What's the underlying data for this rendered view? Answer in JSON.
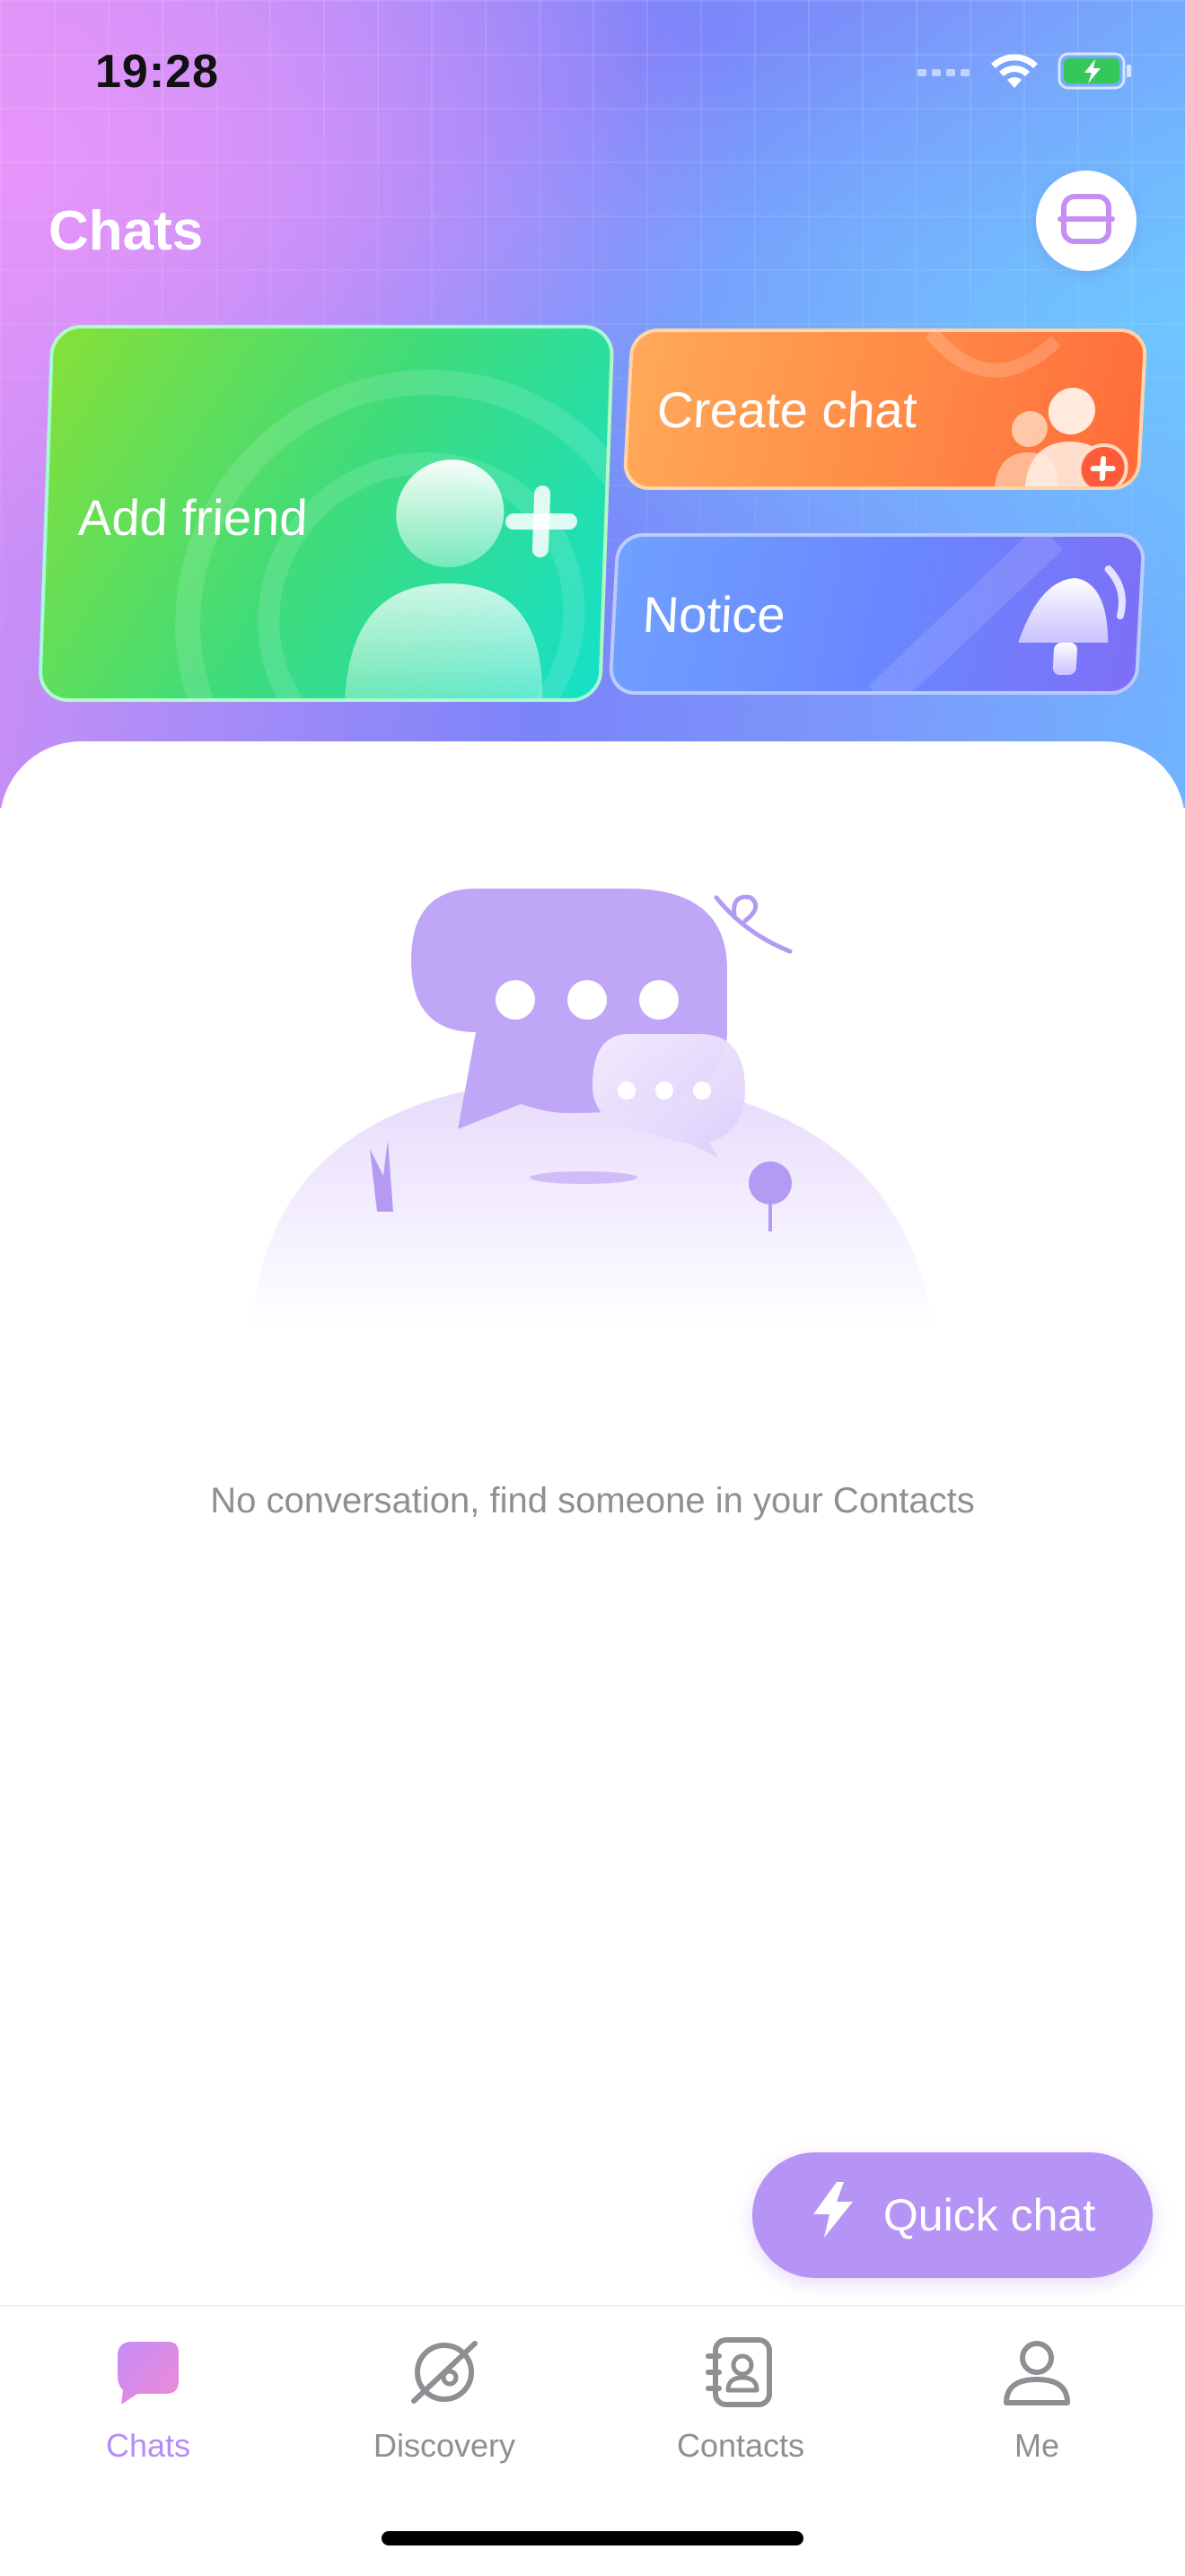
{
  "status_bar": {
    "time": "19:28",
    "icons": [
      "signal-icon",
      "wifi-icon",
      "battery-charging-icon"
    ]
  },
  "header": {
    "title": "Chats",
    "scan_icon": "scan-icon"
  },
  "action_cards": {
    "add_friend": "Add friend",
    "create_chat": "Create chat",
    "notice": "Notice"
  },
  "empty_state": {
    "message": "No conversation, find someone in your Contacts",
    "illustration": "chat-bubbles-illustration"
  },
  "quick_chat": {
    "label": "Quick chat",
    "icon": "lightning-icon"
  },
  "tab_bar": {
    "active": "Chats",
    "items": [
      {
        "label": "Chats",
        "icon": "chat-bubble-icon"
      },
      {
        "label": "Discovery",
        "icon": "planet-icon"
      },
      {
        "label": "Contacts",
        "icon": "address-book-icon"
      },
      {
        "label": "Me",
        "icon": "person-icon"
      }
    ]
  },
  "colors": {
    "accent": "#b58cf5",
    "add_friend": "#3fdc7a",
    "create_chat": "#ff8a46",
    "notice": "#6a86ff",
    "quick_chat": "#b594f5"
  }
}
